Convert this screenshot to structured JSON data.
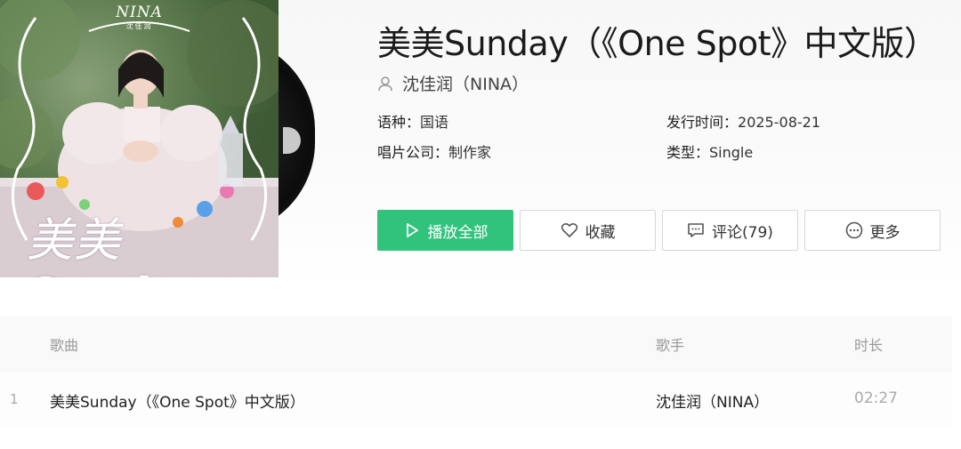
{
  "album": {
    "title": "美美Sunday（《One Spot》中文版）",
    "artist": "沈佳润（NINA）",
    "cover_brand": "NINA",
    "cover_brand_sub": "沈佳润",
    "cover_script": "美美Sunday"
  },
  "meta": {
    "language_label": "语种：",
    "language_value": "国语",
    "release_label": "发行时间：",
    "release_value": "2025-08-21",
    "label_label": "唱片公司：",
    "label_value": "制作家",
    "type_label": "类型：",
    "type_value": "Single"
  },
  "actions": {
    "play_all": "播放全部",
    "favorite": "收藏",
    "comment": "评论(79)",
    "more": "更多"
  },
  "table": {
    "headers": {
      "song": "歌曲",
      "singer": "歌手",
      "duration": "时长"
    },
    "rows": [
      {
        "index": "1",
        "song": "美美Sunday（《One Spot》中文版）",
        "singer": "沈佳润（NINA）",
        "duration": "02:27"
      }
    ]
  },
  "colors": {
    "accent": "#31c27c"
  },
  "icons": [
    "user-icon",
    "play-icon",
    "heart-icon",
    "comment-icon",
    "more-icon"
  ]
}
